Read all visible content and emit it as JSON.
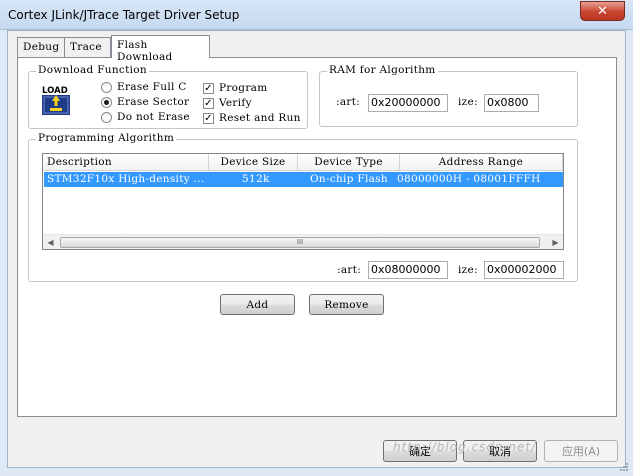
{
  "window": {
    "title": "Cortex JLink/JTrace Target Driver Setup",
    "close_glyph": "✕"
  },
  "tabs": [
    {
      "label": "Debug"
    },
    {
      "label": "Trace"
    },
    {
      "label": "Flash Download"
    }
  ],
  "download_function": {
    "label": "Download Function",
    "icon_text": "LOAD",
    "radios": [
      {
        "label": "Erase Full C",
        "selected": false
      },
      {
        "label": "Erase Sector",
        "selected": true
      },
      {
        "label": "Do not Erase",
        "selected": false
      }
    ],
    "checks": [
      {
        "label": "Program",
        "checked": true,
        "mark": "✓"
      },
      {
        "label": "Verify",
        "checked": true,
        "mark": "✓"
      },
      {
        "label": "Reset and Run",
        "checked": true,
        "mark": "✓"
      }
    ]
  },
  "ram_for_algorithm": {
    "label": "RAM for Algorithm",
    "start_label": ":art:",
    "start_value": "0x20000000",
    "size_label": "ize:",
    "size_value": "0x0800"
  },
  "programming_algorithm": {
    "label": "Programming Algorithm",
    "columns": [
      "Description",
      "Device Size",
      "Device Type",
      "Address Range"
    ],
    "rows": [
      {
        "description": "STM32F10x High-density ...",
        "size": "512k",
        "type": "On-chip Flash",
        "range": "08000000H - 08001FFFH"
      }
    ],
    "scroll_left": "◀",
    "scroll_right": "▶",
    "thumb_grip": "III",
    "start_label": ":art:",
    "start_value": "0x08000000",
    "size_label": "ize:",
    "size_value": "0x00002000"
  },
  "actions": {
    "add": "Add",
    "remove": "Remove"
  },
  "footer": {
    "ok": "确定",
    "cancel": "取消",
    "apply": "应用(A)"
  },
  "watermark": "http://blog.csdn.net/",
  "colors": {
    "selection": "#3399ff",
    "close": "#c7452f",
    "icon_bg": "#1f3c8a",
    "icon_arrow": "#f4d21f"
  }
}
